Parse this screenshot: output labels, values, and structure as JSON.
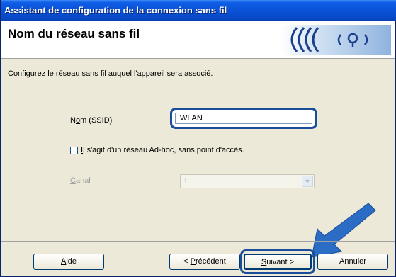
{
  "window": {
    "title": "Assistant de configuration de la connexion sans fil"
  },
  "header": {
    "title": "Nom du réseau sans fil",
    "logo_icon": "wifi-signal-icon"
  },
  "instruction": "Configurez le réseau sans fil auquel l'appareil sera associé.",
  "ssid": {
    "label_pre": "N",
    "label_u": "o",
    "label_post": "m (SSID)",
    "value": "WLAN"
  },
  "adhoc": {
    "checked": false,
    "label_u": "I",
    "label_post": "l s'agit d'un réseau Ad-hoc, sans point d'accès."
  },
  "channel": {
    "label_u": "C",
    "label_post": "anal",
    "value": "1",
    "disabled": true
  },
  "buttons": {
    "help_u": "A",
    "help_post": "ide",
    "prev_pre": "< ",
    "prev_u": "P",
    "prev_post": "récédent",
    "next_u": "S",
    "next_post": "uivant >",
    "cancel": "Annuler"
  },
  "colors": {
    "highlight": "#1a4e9a",
    "arrow": "#2b6cc4"
  }
}
